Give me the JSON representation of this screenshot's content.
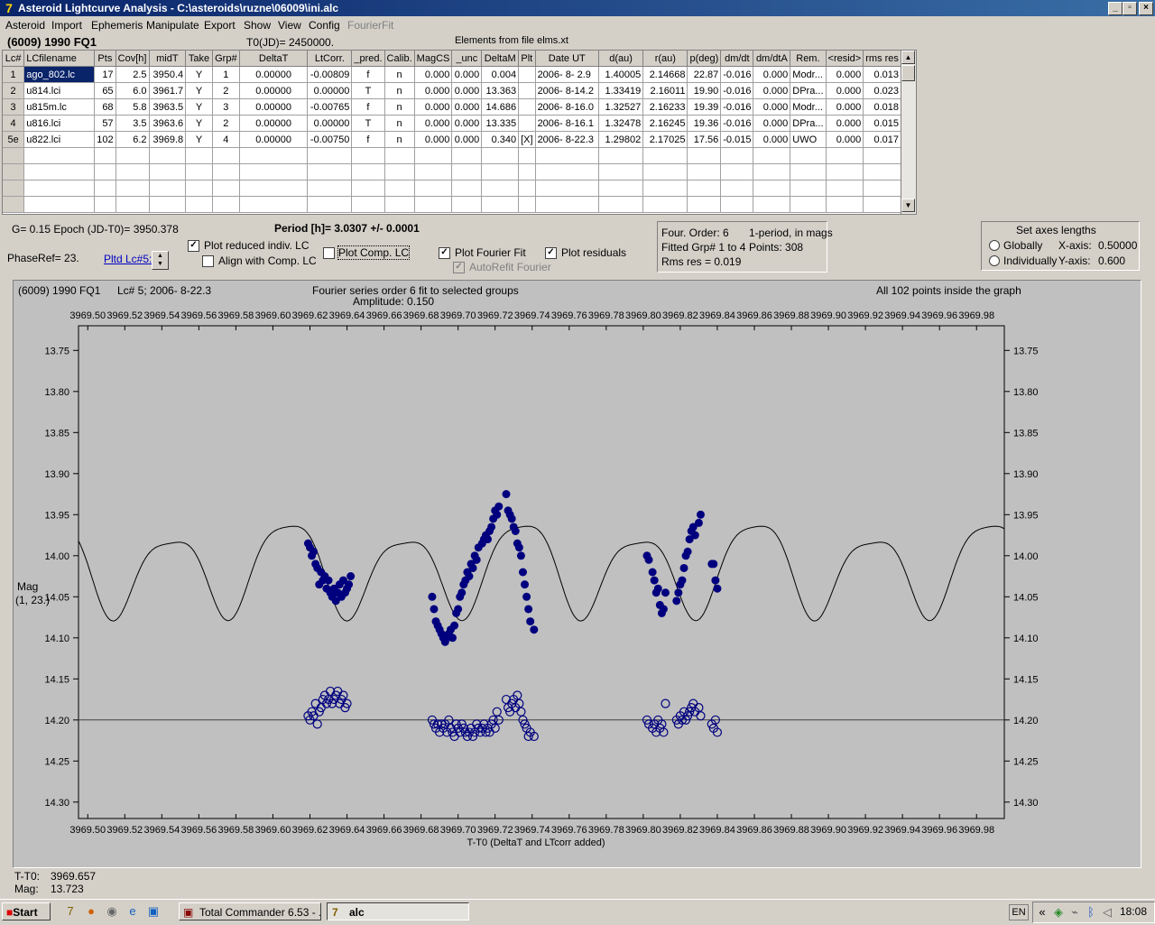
{
  "window": {
    "title": "Asteroid Lightcurve Analysis - C:\\asteroids\\ruzne\\06009\\ini.alc",
    "app_icon": "7-icon",
    "title_bg": "#0a246a"
  },
  "menu": [
    "Asteroid",
    "Import",
    "Ephemeris",
    "Manipulate",
    "Export",
    "Show",
    "View",
    "Config",
    "FourierFit"
  ],
  "info": {
    "asteroid": "(6009) 1990 FQ1",
    "t0": "T0(JD)= 2450000.",
    "elements": "Elements from file elms.xt"
  },
  "table": {
    "headers": [
      "Lc#",
      "LCfilename",
      "Pts",
      "Cov[h]",
      "midT",
      "Take",
      "Grp#",
      "DeltaT",
      "LtCorr.",
      "_pred.",
      "Calib.",
      "MagCS",
      "_unc",
      "DeltaM",
      "Plt",
      "Date UT",
      "d(au)",
      "r(au)",
      "p(deg)",
      "dm/dt",
      "dm/dtA",
      "Rem.",
      "<resid>",
      "rms res"
    ],
    "rows": [
      [
        "1",
        "ago_802.lc",
        "17",
        "2.5",
        "3950.4",
        "Y",
        "1",
        "0.00000",
        "-0.00809",
        "f",
        "n",
        "0.000",
        "0.000",
        "0.004",
        "",
        "2006- 8- 2.9",
        "1.40005",
        "2.14668",
        "22.87",
        "-0.016",
        "0.000",
        "Modr...",
        "0.000",
        "0.013"
      ],
      [
        "2",
        "u814.lci",
        "65",
        "6.0",
        "3961.7",
        "Y",
        "2",
        "0.00000",
        "0.00000",
        "T",
        "n",
        "0.000",
        "0.000",
        "13.363",
        "",
        "2006- 8-14.2",
        "1.33419",
        "2.16011",
        "19.90",
        "-0.016",
        "0.000",
        "DPra...",
        "0.000",
        "0.023"
      ],
      [
        "3",
        "u815m.lc",
        "68",
        "5.8",
        "3963.5",
        "Y",
        "3",
        "0.00000",
        "-0.00765",
        "f",
        "n",
        "0.000",
        "0.000",
        "14.686",
        "",
        "2006- 8-16.0",
        "1.32527",
        "2.16233",
        "19.39",
        "-0.016",
        "0.000",
        "Modr...",
        "0.000",
        "0.018"
      ],
      [
        "4",
        "u816.lci",
        "57",
        "3.5",
        "3963.6",
        "Y",
        "2",
        "0.00000",
        "0.00000",
        "T",
        "n",
        "0.000",
        "0.000",
        "13.335",
        "",
        "2006- 8-16.1",
        "1.32478",
        "2.16245",
        "19.36",
        "-0.016",
        "0.000",
        "DPra...",
        "0.000",
        "0.015"
      ],
      [
        "5e",
        "u822.lci",
        "102",
        "6.2",
        "3969.8",
        "Y",
        "4",
        "0.00000",
        "-0.00750",
        "f",
        "n",
        "0.000",
        "0.000",
        "0.340",
        "[X]",
        "2006- 8-22.3",
        "1.29802",
        "2.17025",
        "17.56",
        "-0.015",
        "0.000",
        "UWO",
        "0.000",
        "0.017"
      ]
    ]
  },
  "controls": {
    "g_epoch": "G= 0.15    Epoch (JD-T0)= 3950.378",
    "period": "Period [h]= 3.0307 +/- 0.0001",
    "phaseref": "PhaseRef= 23.",
    "pltd_lc": "Pltd Lc#5:",
    "plot_reduced": "Plot reduced indiv. LC",
    "align_comp": "Align with Comp. LC",
    "plot_comp": "Plot Comp. LC",
    "plot_fourier": "Plot Fourier Fit",
    "autorefit": "AutoRefit Fourier",
    "plot_residuals": "Plot residuals"
  },
  "fourier_box": {
    "order": "Four. Order:  6",
    "period_mode": "1-period, in mags",
    "fitted": "Fitted Grp# 1 to 4",
    "points": "Points: 308",
    "rms": "Rms res      = 0.019"
  },
  "axes_box": {
    "title": "Set axes lengths",
    "globally": "Globally",
    "individually": "Individually",
    "xaxis_label": "X-axis:",
    "xaxis_value": "0.50000",
    "yaxis_label": "Y-axis:",
    "yaxis_value": "0.600"
  },
  "graph": {
    "header_left": "(6009) 1990 FQ1",
    "header_lc": "Lc# 5; 2006- 8-22.3",
    "header_center": "Fourier series order 6 fit to selected groups",
    "amplitude": "Amplitude: 0.150",
    "header_right": "All 102 points inside the graph",
    "xlabel": "T-T0 (DeltaT and LTcorr added)",
    "ylabel": "Mag",
    "ylabel2": "(1, 23.)"
  },
  "chart_data": {
    "type": "scatter",
    "xlabel": "T-T0 (DeltaT and LTcorr added)",
    "ylabel": "Mag",
    "xlim": [
      3969.495,
      3969.995
    ],
    "ylim": [
      14.32,
      13.72
    ],
    "x_ticks": [
      "3969.50",
      "3969.52",
      "3969.54",
      "3969.56",
      "3969.58",
      "3969.60",
      "3969.62",
      "3969.64",
      "3969.66",
      "3969.68",
      "3969.70",
      "3969.72",
      "3969.74",
      "3969.76",
      "3969.78",
      "3969.80",
      "3969.82",
      "3969.84",
      "3969.86",
      "3969.88",
      "3969.90",
      "3969.92",
      "3969.94",
      "3969.96",
      "3969.98"
    ],
    "y_ticks": [
      "13.75",
      "13.80",
      "13.85",
      "13.90",
      "13.95",
      "14.00",
      "14.05",
      "14.10",
      "14.15",
      "14.20",
      "14.25",
      "14.30"
    ],
    "residual_baseline": 14.2,
    "colors": {
      "points": "#00007f",
      "curve": "#000000",
      "plot_bg": "#c0c0c0"
    },
    "series": [
      {
        "values": [
          [
            3969.619,
            13.985
          ],
          [
            3969.62,
            13.99
          ],
          [
            3969.621,
            14.0
          ],
          [
            3969.622,
            13.995
          ],
          [
            3969.623,
            14.01
          ],
          [
            3969.624,
            14.015
          ],
          [
            3969.625,
            14.035
          ],
          [
            3969.626,
            14.02
          ],
          [
            3969.627,
            14.03
          ],
          [
            3969.628,
            14.025
          ],
          [
            3969.629,
            14.04
          ],
          [
            3969.63,
            14.03
          ],
          [
            3969.631,
            14.045
          ],
          [
            3969.632,
            14.05
          ],
          [
            3969.633,
            14.04
          ],
          [
            3969.634,
            14.055
          ],
          [
            3969.635,
            14.045
          ],
          [
            3969.636,
            14.035
          ],
          [
            3969.637,
            14.05
          ],
          [
            3969.638,
            14.03
          ],
          [
            3969.639,
            14.045
          ],
          [
            3969.64,
            14.04
          ],
          [
            3969.641,
            14.035
          ],
          [
            3969.642,
            14.025
          ],
          [
            3969.686,
            14.05
          ],
          [
            3969.687,
            14.065
          ],
          [
            3969.688,
            14.08
          ],
          [
            3969.689,
            14.085
          ],
          [
            3969.69,
            14.09
          ],
          [
            3969.691,
            14.095
          ],
          [
            3969.692,
            14.1
          ],
          [
            3969.693,
            14.105
          ],
          [
            3969.694,
            14.1
          ],
          [
            3969.695,
            14.095
          ],
          [
            3969.696,
            14.09
          ],
          [
            3969.697,
            14.1
          ],
          [
            3969.698,
            14.085
          ],
          [
            3969.699,
            14.07
          ],
          [
            3969.7,
            14.065
          ],
          [
            3969.701,
            14.05
          ],
          [
            3969.702,
            14.045
          ],
          [
            3969.703,
            14.035
          ],
          [
            3969.704,
            14.03
          ],
          [
            3969.705,
            14.02
          ],
          [
            3969.706,
            14.025
          ],
          [
            3969.707,
            14.01
          ],
          [
            3969.708,
            14.015
          ],
          [
            3969.709,
            14.0
          ],
          [
            3969.71,
            14.005
          ],
          [
            3969.711,
            13.99
          ],
          [
            3969.713,
            13.985
          ],
          [
            3969.714,
            13.98
          ],
          [
            3969.715,
            13.975
          ],
          [
            3969.716,
            13.98
          ],
          [
            3969.717,
            13.97
          ],
          [
            3969.718,
            13.965
          ],
          [
            3969.719,
            13.955
          ],
          [
            3969.72,
            13.945
          ],
          [
            3969.721,
            13.95
          ],
          [
            3969.722,
            13.94
          ],
          [
            3969.726,
            13.925
          ],
          [
            3969.727,
            13.945
          ],
          [
            3969.728,
            13.95
          ],
          [
            3969.729,
            13.955
          ],
          [
            3969.73,
            13.965
          ],
          [
            3969.731,
            13.97
          ],
          [
            3969.732,
            13.985
          ],
          [
            3969.733,
            13.99
          ],
          [
            3969.734,
            14.0
          ],
          [
            3969.735,
            14.02
          ],
          [
            3969.736,
            14.035
          ],
          [
            3969.737,
            14.05
          ],
          [
            3969.738,
            14.065
          ],
          [
            3969.739,
            14.08
          ],
          [
            3969.741,
            14.09
          ],
          [
            3969.802,
            14.0
          ],
          [
            3969.803,
            14.005
          ],
          [
            3969.805,
            14.02
          ],
          [
            3969.806,
            14.03
          ],
          [
            3969.807,
            14.045
          ],
          [
            3969.808,
            14.04
          ],
          [
            3969.809,
            14.06
          ],
          [
            3969.81,
            14.07
          ],
          [
            3969.811,
            14.065
          ],
          [
            3969.812,
            14.045
          ],
          [
            3969.818,
            14.055
          ],
          [
            3969.819,
            14.045
          ],
          [
            3969.82,
            14.035
          ],
          [
            3969.821,
            14.03
          ],
          [
            3969.822,
            14.015
          ],
          [
            3969.823,
            14.0
          ],
          [
            3969.824,
            13.995
          ],
          [
            3969.825,
            13.98
          ],
          [
            3969.826,
            13.97
          ],
          [
            3969.827,
            13.965
          ],
          [
            3969.828,
            13.975
          ],
          [
            3969.83,
            13.96
          ],
          [
            3969.831,
            13.95
          ],
          [
            3969.837,
            14.01
          ],
          [
            3969.838,
            14.01
          ],
          [
            3969.839,
            14.03
          ],
          [
            3969.84,
            14.04
          ]
        ]
      },
      {
        "values": [
          [
            3969.619,
            14.195
          ],
          [
            3969.62,
            14.2
          ],
          [
            3969.621,
            14.19
          ],
          [
            3969.622,
            14.195
          ],
          [
            3969.623,
            14.18
          ],
          [
            3969.624,
            14.205
          ],
          [
            3969.625,
            14.19
          ],
          [
            3969.626,
            14.185
          ],
          [
            3969.627,
            14.175
          ],
          [
            3969.628,
            14.17
          ],
          [
            3969.629,
            14.18
          ],
          [
            3969.63,
            14.175
          ],
          [
            3969.631,
            14.165
          ],
          [
            3969.632,
            14.18
          ],
          [
            3969.633,
            14.175
          ],
          [
            3969.634,
            14.17
          ],
          [
            3969.635,
            14.165
          ],
          [
            3969.636,
            14.18
          ],
          [
            3969.637,
            14.175
          ],
          [
            3969.638,
            14.17
          ],
          [
            3969.639,
            14.185
          ],
          [
            3969.64,
            14.18
          ],
          [
            3969.686,
            14.2
          ],
          [
            3969.687,
            14.205
          ],
          [
            3969.688,
            14.21
          ],
          [
            3969.689,
            14.205
          ],
          [
            3969.69,
            14.215
          ],
          [
            3969.691,
            14.205
          ],
          [
            3969.692,
            14.21
          ],
          [
            3969.693,
            14.205
          ],
          [
            3969.694,
            14.215
          ],
          [
            3969.695,
            14.2
          ],
          [
            3969.696,
            14.21
          ],
          [
            3969.697,
            14.215
          ],
          [
            3969.698,
            14.22
          ],
          [
            3969.699,
            14.205
          ],
          [
            3969.7,
            14.21
          ],
          [
            3969.701,
            14.215
          ],
          [
            3969.702,
            14.205
          ],
          [
            3969.703,
            14.21
          ],
          [
            3969.704,
            14.215
          ],
          [
            3969.705,
            14.22
          ],
          [
            3969.706,
            14.215
          ],
          [
            3969.707,
            14.21
          ],
          [
            3969.708,
            14.22
          ],
          [
            3969.709,
            14.215
          ],
          [
            3969.71,
            14.205
          ],
          [
            3969.711,
            14.21
          ],
          [
            3969.712,
            14.215
          ],
          [
            3969.713,
            14.21
          ],
          [
            3969.714,
            14.205
          ],
          [
            3969.715,
            14.215
          ],
          [
            3969.716,
            14.21
          ],
          [
            3969.717,
            14.215
          ],
          [
            3969.718,
            14.205
          ],
          [
            3969.719,
            14.2
          ],
          [
            3969.72,
            14.21
          ],
          [
            3969.721,
            14.19
          ],
          [
            3969.722,
            14.2
          ],
          [
            3969.726,
            14.175
          ],
          [
            3969.727,
            14.185
          ],
          [
            3969.728,
            14.19
          ],
          [
            3969.729,
            14.18
          ],
          [
            3969.73,
            14.175
          ],
          [
            3969.731,
            14.185
          ],
          [
            3969.732,
            14.17
          ],
          [
            3969.733,
            14.18
          ],
          [
            3969.734,
            14.19
          ],
          [
            3969.735,
            14.2
          ],
          [
            3969.736,
            14.205
          ],
          [
            3969.737,
            14.21
          ],
          [
            3969.738,
            14.22
          ],
          [
            3969.739,
            14.215
          ],
          [
            3969.741,
            14.22
          ],
          [
            3969.802,
            14.2
          ],
          [
            3969.803,
            14.205
          ],
          [
            3969.805,
            14.21
          ],
          [
            3969.806,
            14.205
          ],
          [
            3969.807,
            14.215
          ],
          [
            3969.808,
            14.2
          ],
          [
            3969.809,
            14.21
          ],
          [
            3969.81,
            14.205
          ],
          [
            3969.811,
            14.215
          ],
          [
            3969.812,
            14.18
          ],
          [
            3969.818,
            14.2
          ],
          [
            3969.819,
            14.205
          ],
          [
            3969.82,
            14.195
          ],
          [
            3969.821,
            14.2
          ],
          [
            3969.822,
            14.19
          ],
          [
            3969.823,
            14.2
          ],
          [
            3969.824,
            14.195
          ],
          [
            3969.825,
            14.19
          ],
          [
            3969.826,
            14.185
          ],
          [
            3969.827,
            14.18
          ],
          [
            3969.828,
            14.19
          ],
          [
            3969.83,
            14.185
          ],
          [
            3969.831,
            14.195
          ],
          [
            3969.837,
            14.205
          ],
          [
            3969.838,
            14.21
          ],
          [
            3969.839,
            14.2
          ],
          [
            3969.84,
            14.215
          ]
        ]
      }
    ],
    "fourier_curve": {
      "period_hours": 3.0307,
      "amplitude": 0.15
    }
  },
  "status": {
    "t_t0_label": "T-T0:",
    "t_t0_value": "3969.657",
    "mag_label": "Mag:",
    "mag_value": "13.723"
  },
  "taskbar": {
    "start": "Start",
    "buttons": [
      "Total Commander 6.53 - ...",
      "alc"
    ],
    "lang": "EN",
    "clock": "18:08"
  }
}
